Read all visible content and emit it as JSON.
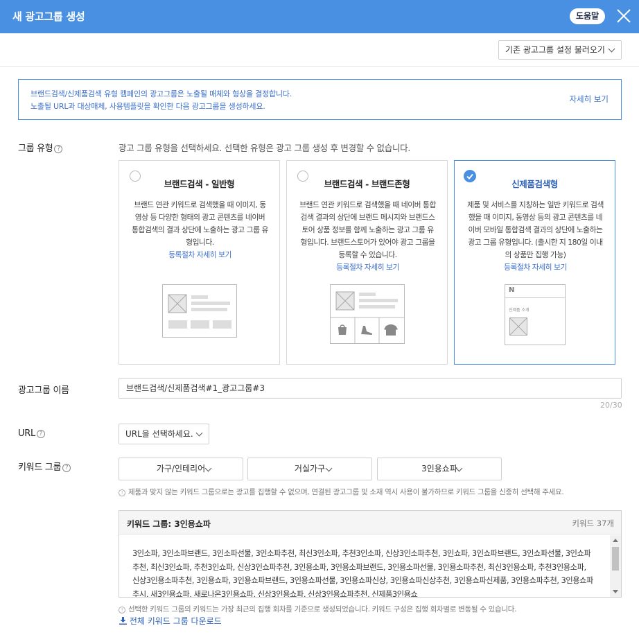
{
  "header": {
    "title": "새 광고그룹 생성",
    "help_label": "도움말"
  },
  "toolbar": {
    "load_settings_label": "기존 광고그룹 설정 불러오기"
  },
  "notice": {
    "line1": "브랜드검색/신제품검색 유형 캠페인의 광고그룹은 노출될 매체와 형상을 결정합니다.",
    "line2": "노출될 URL과 대상매체, 사용템플릿을 확인한 다음 광고그룹을 생성하세요.",
    "more_label": "자세히 보기"
  },
  "group_type": {
    "label": "그룹 유형",
    "description": "광고 그룹 유형을 선택하세요. 선택한 유형은 광고 그룹 생성 후 변경할 수 없습니다.",
    "cards": [
      {
        "title": "브랜드검색 - 일반형",
        "body": "브랜드 연관 키워드로 검색했을 때 이미지, 동영상 등 다양한 형태의 광고 콘텐츠를 네이버 통합검색의 결과 상단에 노출하는 광고 그룹 유형입니다.",
        "link": "등록절차 자세히 보기",
        "selected": false
      },
      {
        "title": "브랜드검색 - 브랜드존형",
        "body": "브랜드 연관 키워드로 검색했을 때 네이버 통합검색 결과의 상단에 브랜드 메시지와 브랜드스토어 상품 정보를 함께 노출하는 광고 그룹 유형입니다. 브랜드스토어가 있어야 광고 그룹을 등록할 수 있습니다.",
        "link": "등록절차 자세히 보기",
        "selected": false
      },
      {
        "title": "신제품검색형",
        "body": "제품 및 서비스를 지칭하는 일반 키워드로 검색했을 때 이미지, 동영상 등의 광고 콘텐츠를 네이버 모바일 통합검색 결과의 상단에 노출하는 광고 그룹 유형입니다. (출시한 지 180일 이내의 상품만 집행 가능)",
        "link": "등록절차 자세히 보기",
        "selected": true,
        "illus_text": "신제품 소개",
        "illus_logo": "N"
      }
    ]
  },
  "ad_group_name": {
    "label": "광고그룹 이름",
    "value": "브랜드검색/신제품검색#1_광고그룹#3",
    "counter": "20/30"
  },
  "url": {
    "label": "URL",
    "select_value": "URL을 선택하세요."
  },
  "keyword_group": {
    "label": "키워드 그룹",
    "selects": [
      "가구/인테리어",
      "거실가구",
      "3인용쇼파"
    ],
    "hint": "제품과 맞지 않는 키워드 그룹으로는 광고를 집행할 수 없으며, 연결된 광고그룹 및 소재 역시 사용이 불가하므로 키워드 그룹을 신중히 선택해 주세요.",
    "box_title": "키워드 그룹: 3인용쇼파",
    "box_count": "키워드 37개",
    "keywords": "3인소파, 3인소파브랜드, 3인소파선물, 3인소파추천, 최신3인소파, 추천3인소파, 신상3인소파추천, 3인쇼파, 3인쇼파브랜드, 3인쇼파선물, 3인쇼파추천, 최신3인쇼파, 추천3인쇼파, 신상3인쇼파추천, 3인용소파, 3인용소파브랜드, 3인용소파선물, 3인용소파추천, 최신3인용소파, 추천3인용소파, 신상3인용소파추천, 3인용쇼파, 3인용쇼파브랜드, 3인용쇼파선물, 3인용쇼파신상, 3인용쇼파신상추천, 3인용쇼파신제품, 3인용쇼파추천, 3인용쇼파추시, 새3인용쇼파, 새로나온3인용쇼파, 신상3인용쇼파, 신상3인용쇼파추천, 신제품3인용쇼",
    "footer_hint": "선택한 키워드 그룹의 키워드는 가장 최근의 집행 회차를 기준으로 생성되었습니다. 키워드 구성은 집행 회차별로 변동될 수 있습니다.",
    "download_label": "전체 키워드 그룹 다운로드"
  }
}
